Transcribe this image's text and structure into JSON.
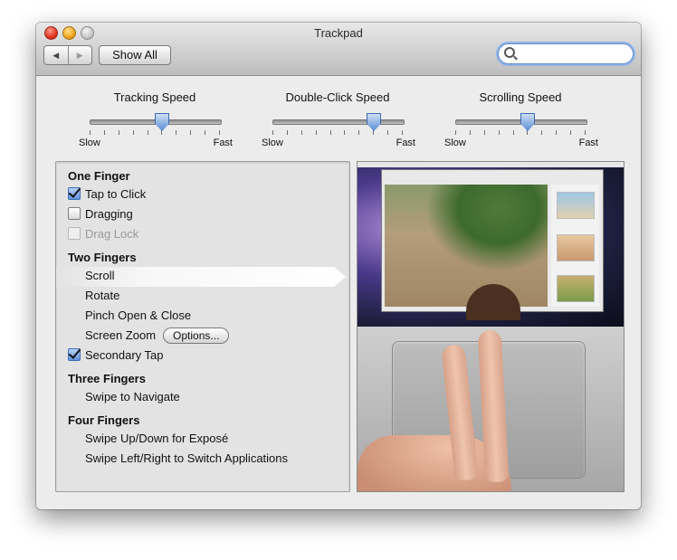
{
  "window": {
    "title": "Trackpad"
  },
  "toolbar": {
    "back_label": "◀",
    "forward_label": "▶",
    "show_all_label": "Show All",
    "search_placeholder": ""
  },
  "sliders": [
    {
      "label": "Tracking Speed",
      "min_label": "Slow",
      "max_label": "Fast",
      "value": 0.55,
      "ticks": 10
    },
    {
      "label": "Double-Click Speed",
      "min_label": "Slow",
      "max_label": "Fast",
      "value": 0.77,
      "ticks": 10
    },
    {
      "label": "Scrolling Speed",
      "min_label": "Slow",
      "max_label": "Fast",
      "value": 0.55,
      "ticks": 10
    }
  ],
  "gestures": {
    "one_finger": {
      "title": "One Finger",
      "tap_to_click": {
        "label": "Tap to Click",
        "checked": true
      },
      "dragging": {
        "label": "Dragging",
        "checked": false
      },
      "drag_lock": {
        "label": "Drag Lock",
        "checked": false,
        "enabled": false
      }
    },
    "two_fingers": {
      "title": "Two Fingers",
      "scroll": "Scroll",
      "rotate": "Rotate",
      "pinch": "Pinch Open & Close",
      "screen_zoom": "Screen Zoom",
      "options_label": "Options...",
      "secondary_tap": {
        "label": "Secondary Tap",
        "checked": true
      }
    },
    "three_fingers": {
      "title": "Three Fingers",
      "swipe": "Swipe to Navigate"
    },
    "four_fingers": {
      "title": "Four Fingers",
      "updown": "Swipe Up/Down for Exposé",
      "leftright": "Swipe Left/Right to Switch Applications"
    },
    "selected": "Scroll"
  },
  "colors": {
    "accent": "#5f93db",
    "window_bg": "#ececec"
  }
}
